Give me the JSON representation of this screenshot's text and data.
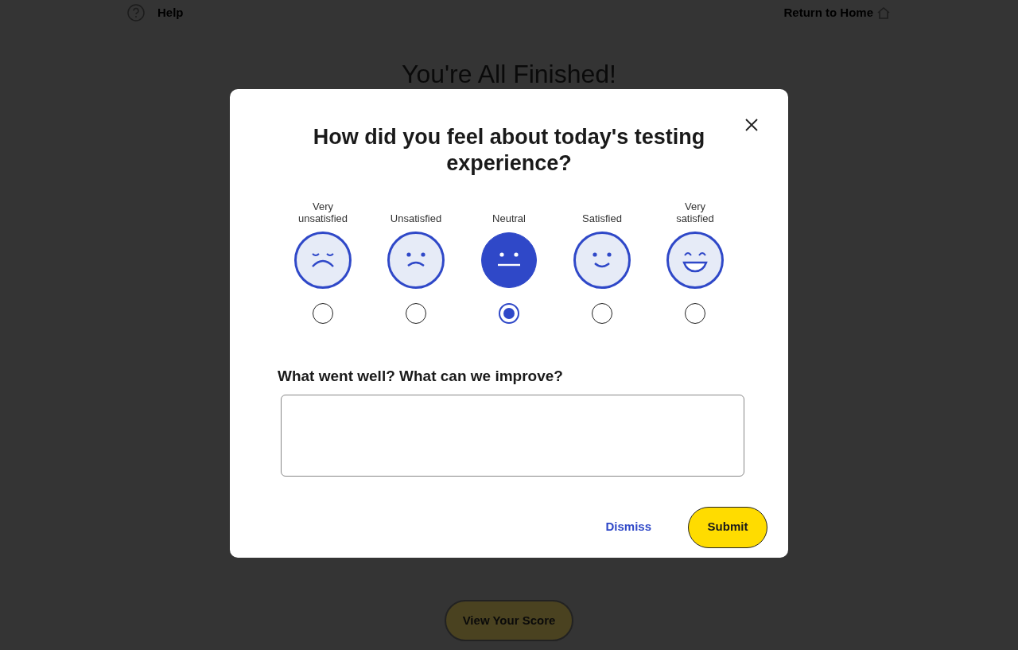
{
  "header": {
    "help": "Help",
    "home": "Return to Home"
  },
  "page": {
    "title": "You're All Finished!",
    "score_button": "View Your Score"
  },
  "dialog": {
    "title": "How did you feel about today's testing experience?",
    "options": [
      {
        "label": "Very unsatisfied",
        "kind": "miserable",
        "selected": false
      },
      {
        "label": "Unsatisfied",
        "kind": "sad",
        "selected": false
      },
      {
        "label": "Neutral",
        "kind": "neutral",
        "selected": true
      },
      {
        "label": "Satisfied",
        "kind": "smile",
        "selected": false
      },
      {
        "label": "Very satisfied",
        "kind": "grin",
        "selected": false
      }
    ],
    "feedback_label": "What went well? What can we improve?",
    "dismiss": "Dismiss",
    "submit": "Submit"
  }
}
